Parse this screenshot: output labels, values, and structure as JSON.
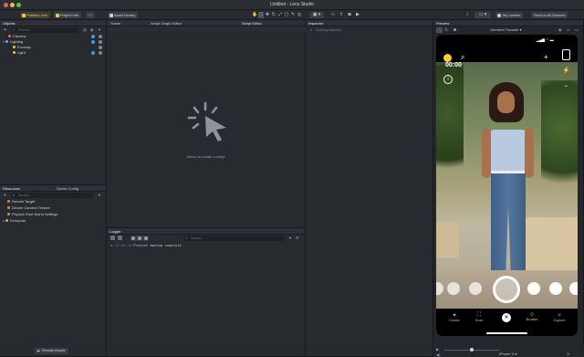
{
  "window": {
    "title": "Untitled - Lens Studio"
  },
  "toolbar": {
    "project_lens": "Publish Lens",
    "project_info": "Project Info",
    "third_tab": "Hl",
    "asset_library": "Asset Library",
    "my_lenses": "My Lenses",
    "send_to_devices": "Send to All Devices"
  },
  "objects_panel": {
    "title": "Objects",
    "search_placeholder": "Search...",
    "items": [
      {
        "label": "Camera",
        "color": "#e86a5a"
      },
      {
        "label": "Lighting",
        "color": "#6aa7e8"
      },
      {
        "label": "Envmap",
        "color": "#e8c94a"
      },
      {
        "label": "Light",
        "color": "#e8c94a"
      }
    ]
  },
  "resources_panel": {
    "tab_resources": "Resources",
    "tab_scene_config": "Scene Config",
    "search_placeholder": "Search...",
    "items": [
      {
        "label": "Render Target",
        "color": "#d37a4a"
      },
      {
        "label": "Device Camera Texture",
        "color": "#d37a4a"
      },
      {
        "label": "Physics Root World Settings",
        "color": "#8a8f96"
      },
      {
        "label": "Echopark",
        "color": "#c2a14a"
      }
    ],
    "remote_assets": "Remote Assets"
  },
  "scene_panel": {
    "tab_scene": "Scene",
    "tab_script_graph": "Script Graph Editor",
    "tab_script_editor": "Script Editor",
    "hint": "Select or create a script"
  },
  "logger_panel": {
    "title": "Logger",
    "search_placeholder": "Search...",
    "log_time": "18:09:28",
    "log_message": "Project backup complete"
  },
  "inspector_panel": {
    "title": "Inspector",
    "empty_text": "Nothing selected"
  },
  "preview_panel": {
    "title": "Preview",
    "lens_select": "Garment Transfer",
    "timer": "00:00",
    "bottom_nav": [
      "Create",
      "Scan",
      "",
      "Browse",
      "Explore"
    ],
    "device": "iPhone X"
  },
  "colors": {
    "accent": "#f5cb3c",
    "panel": "#272a2f"
  }
}
